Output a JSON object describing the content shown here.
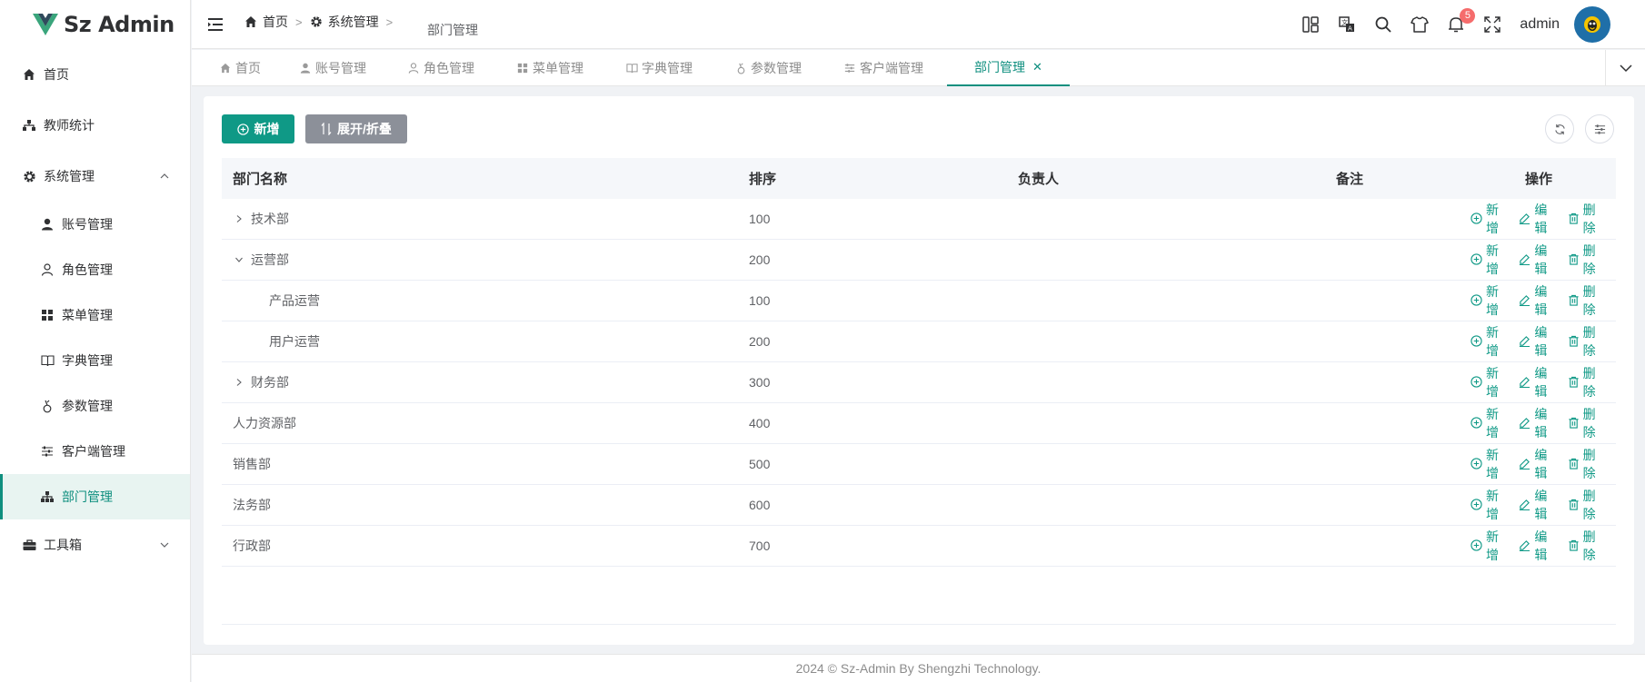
{
  "app": {
    "logo_text": "Sz Admin"
  },
  "sidebar": {
    "items": [
      {
        "label": "首页",
        "icon": "home-icon"
      },
      {
        "label": "教师统计",
        "icon": "hierarchy-icon"
      },
      {
        "label": "系统管理",
        "icon": "gear-icon",
        "expanded": true
      },
      {
        "label": "账号管理",
        "icon": "user-solid-icon"
      },
      {
        "label": "角色管理",
        "icon": "user-outline-icon"
      },
      {
        "label": "菜单管理",
        "icon": "grid-icon"
      },
      {
        "label": "字典管理",
        "icon": "book-icon"
      },
      {
        "label": "参数管理",
        "icon": "param-icon"
      },
      {
        "label": "客户端管理",
        "icon": "sliders-icon"
      },
      {
        "label": "部门管理",
        "icon": "hierarchy-icon",
        "active": true
      },
      {
        "label": "工具箱",
        "icon": "toolbox-icon",
        "expanded": false
      }
    ]
  },
  "header": {
    "breadcrumb": [
      "首页",
      "系统管理"
    ],
    "breadcrumb_current": "部门管理",
    "notification_count": "5",
    "username": "admin"
  },
  "tabs": [
    {
      "label": "首页"
    },
    {
      "label": "账号管理"
    },
    {
      "label": "角色管理"
    },
    {
      "label": "菜单管理"
    },
    {
      "label": "字典管理"
    },
    {
      "label": "参数管理"
    },
    {
      "label": "客户端管理"
    },
    {
      "label": "部门管理",
      "active": true
    }
  ],
  "toolbar": {
    "add_label": "新增",
    "toggle_label": "展开/折叠"
  },
  "table": {
    "headers": {
      "name": "部门名称",
      "sort": "排序",
      "owner": "负责人",
      "remark": "备注",
      "ops": "操作"
    },
    "op_labels": {
      "add": "新增",
      "edit": "编辑",
      "delete": "删除"
    },
    "rows": [
      {
        "name": "技术部",
        "sort": "100",
        "expander": "collapsed"
      },
      {
        "name": "运营部",
        "sort": "200",
        "expander": "expanded"
      },
      {
        "name": "产品运营",
        "sort": "100",
        "child": true
      },
      {
        "name": "用户运营",
        "sort": "200",
        "child": true
      },
      {
        "name": "财务部",
        "sort": "300",
        "expander": "collapsed"
      },
      {
        "name": "人力资源部",
        "sort": "400"
      },
      {
        "name": "销售部",
        "sort": "500"
      },
      {
        "name": "法务部",
        "sort": "600"
      },
      {
        "name": "行政部",
        "sort": "700"
      }
    ]
  },
  "footer": {
    "text": "2024 © Sz-Admin By Shengzhi Technology."
  },
  "colors": {
    "accent": "#0f9986",
    "badge": "#f56c6c",
    "secondary_button": "#8c9099"
  }
}
